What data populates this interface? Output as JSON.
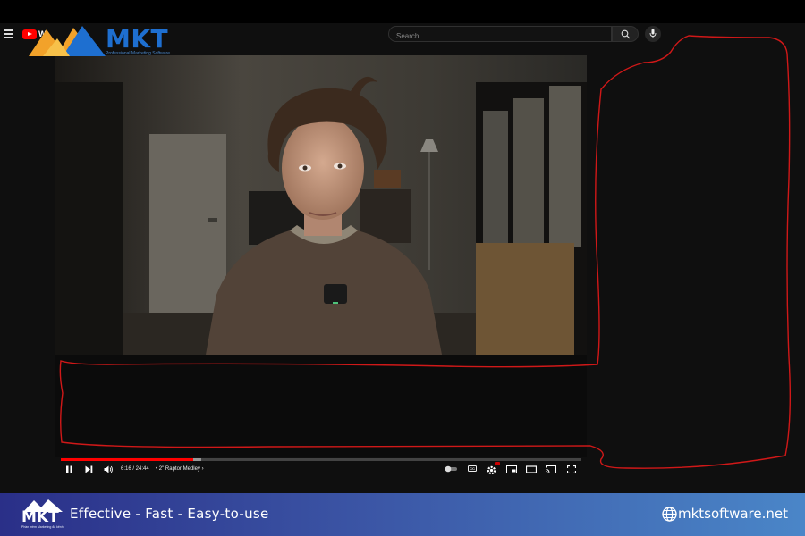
{
  "header": {
    "youtube_logo_text": "W",
    "search_placeholder": "Search"
  },
  "watermark": {
    "brand": "MKT",
    "tagline": "Professional Marketing Software"
  },
  "player": {
    "time": "6:16 / 24:44",
    "chapter": "• 2\" Raptor Medley",
    "chapter_chevron": "›",
    "cc_label": "CC",
    "progress_played": 0.254,
    "progress_buffered_end": 0.27,
    "accent_color": "#ff0000"
  },
  "banner": {
    "logo_text": "MKT",
    "logo_sub": "Phần mềm Marketing đa kênh",
    "slogan": "Effective - Fast - Easy-to-use",
    "website": "mktsoftware.net",
    "gradient_start": "#2a2f88",
    "gradient_end": "#4a86c8"
  },
  "annotation": {
    "color": "#d01818"
  }
}
